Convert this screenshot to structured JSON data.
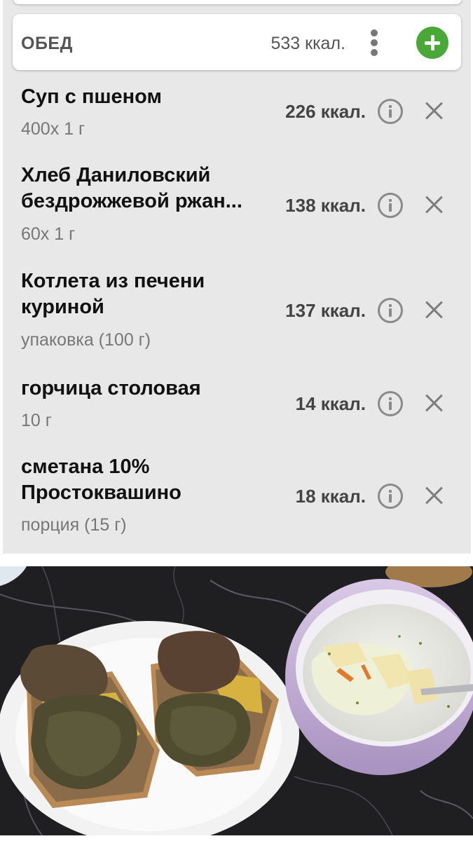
{
  "meal": {
    "title": "ОБЕД",
    "kcal": "533 ккал.",
    "menu_icon": "kebab-menu-icon",
    "add_icon": "plus-icon",
    "accent_color": "#4aa839"
  },
  "items": [
    {
      "name": "Суп с пшеном",
      "portion": "400x 1 г",
      "kcal": "226 ккал."
    },
    {
      "name": "Хлеб Даниловский бездрожжевой ржан...",
      "portion": "60x 1 г",
      "kcal": "138 ккал."
    },
    {
      "name": "Котлета из печени куриной",
      "portion": "упаковка (100 г)",
      "kcal": "137 ккал."
    },
    {
      "name": "горчица столовая",
      "portion": "10 г",
      "kcal": "14 ккал."
    },
    {
      "name": "сметана 10% Простоквашино",
      "portion": "порция (15 г)",
      "kcal": "18 ккал."
    }
  ]
}
